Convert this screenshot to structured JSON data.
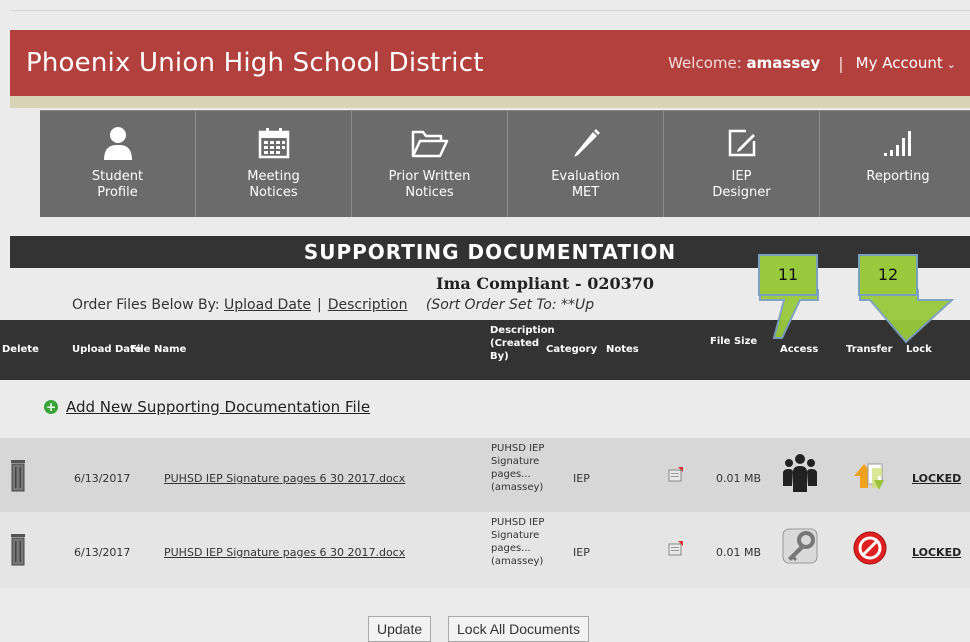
{
  "header": {
    "district": "Phoenix Union High School District",
    "welcome_prefix": "Welcome:",
    "username": "amassey",
    "separator": "|",
    "account": "My Account"
  },
  "nav": [
    {
      "line1": "Student",
      "line2": "Profile",
      "icon": "user-icon"
    },
    {
      "line1": "Meeting",
      "line2": "Notices",
      "icon": "calendar-icon"
    },
    {
      "line1": "Prior Written",
      "line2": "Notices",
      "icon": "folder-icon"
    },
    {
      "line1": "Evaluation",
      "line2": "MET",
      "icon": "pencil-icon"
    },
    {
      "line1": "IEP",
      "line2": "Designer",
      "icon": "edit-box-icon"
    },
    {
      "line1": "Reporting",
      "line2": "",
      "icon": "signal-bars-icon"
    }
  ],
  "section_title": "SUPPORTING DOCUMENTATION",
  "student_name": "Ima Compliant - 020370",
  "order": {
    "label": "Order Files Below By:",
    "upload_date": "Upload Date",
    "pipe": "|",
    "description": "Description",
    "sort_note": "(Sort Order Set To:  **Up"
  },
  "table_headers": {
    "delete": "Delete",
    "upload_date": "Upload Date",
    "file_name": "File Name",
    "description": "Description (Created By)",
    "category": "Category",
    "notes": "Notes",
    "file_size": "File Size",
    "access": "Access",
    "transfer": "Transfer",
    "lock": "Lock"
  },
  "add_new": "Add New Supporting Documentation File",
  "rows": [
    {
      "date": "6/13/2017",
      "file": "PUHSD IEP Signature pages 6 30 2017.docx",
      "desc": "PUHSD IEP Signature pages... (amassey)",
      "category": "IEP",
      "size": "0.01 MB",
      "access_icon": "group-icon",
      "transfer_icon": "transfer-icon",
      "lock": "LOCKED"
    },
    {
      "date": "6/13/2017",
      "file": "PUHSD IEP Signature pages 6 30 2017.docx",
      "desc": "PUHSD IEP Signature pages... (amassey)",
      "category": "IEP",
      "size": "0.01 MB",
      "access_icon": "key-icon",
      "transfer_icon": "no-entry-icon",
      "lock": "LOCKED"
    }
  ],
  "buttons": {
    "update": "Update",
    "lock_all": "Lock All Documents"
  },
  "callouts": {
    "a": "11",
    "b": "12"
  },
  "colors": {
    "header": "#b2403d",
    "nav": "#6b6b6b",
    "dark_bar": "#333333",
    "callout": "#99c93d"
  }
}
